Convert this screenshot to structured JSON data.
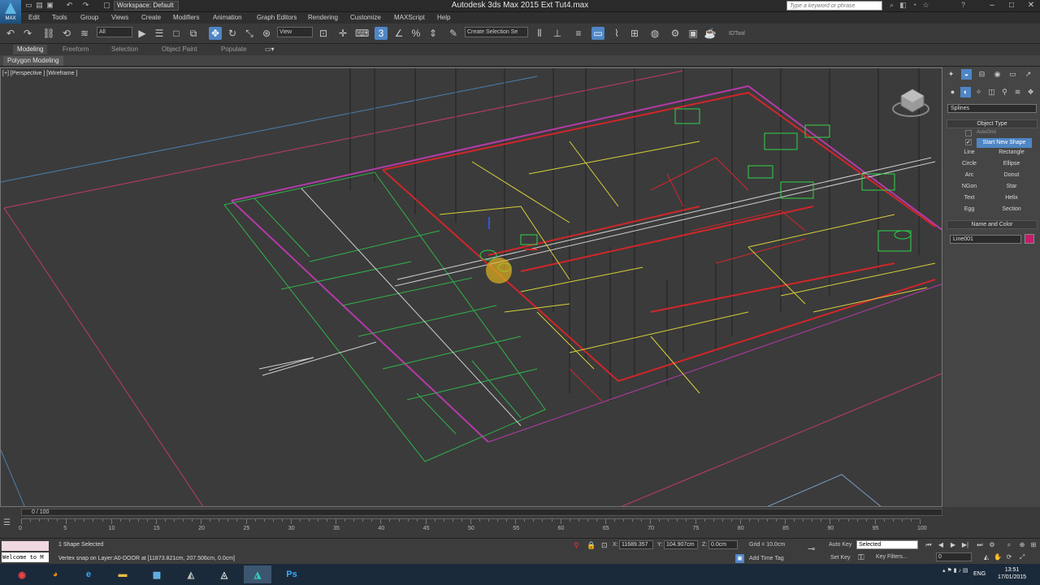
{
  "window": {
    "title": "Autodesk 3ds Max  2015     Ext Tut4.max",
    "workspace": "Workspace: Default",
    "search_placeholder": "Type a keyword or phrase",
    "logo_label": "MAX"
  },
  "menubar": {
    "items": [
      "Edit",
      "Tools",
      "Group",
      "Views",
      "Create",
      "Modifiers",
      "Animation",
      "Graph Editors",
      "Rendering",
      "Customize",
      "MAXScript",
      "Help"
    ]
  },
  "toolbar": {
    "selection_filter": "All",
    "ref_coord": "View",
    "named_selection": "Create Selection Se",
    "idtool_label": "IDTool"
  },
  "ribbon": {
    "tabs": [
      "Modeling",
      "Freeform",
      "Selection",
      "Object Paint",
      "Populate"
    ],
    "active_tab": "Modeling",
    "panel": "Polygon Modeling"
  },
  "viewport": {
    "label": "[+] [Perspective ] [Wireframe ]"
  },
  "command_panel": {
    "category": "Splines",
    "object_type_title": "Object Type",
    "autogrid": "AutoGrid",
    "start_new_shape": "Start New Shape",
    "buttons": [
      [
        "Line",
        "Rectangle"
      ],
      [
        "Circle",
        "Ellipse"
      ],
      [
        "Arc",
        "Donut"
      ],
      [
        "NGon",
        "Star"
      ],
      [
        "Text",
        "Helix"
      ],
      [
        "Egg",
        "Section"
      ]
    ],
    "name_color_title": "Name and Color",
    "object_name": "Line001",
    "object_color": "#c21f6b"
  },
  "timeline": {
    "frame_label": "0 / 100",
    "ticks": [
      "0",
      "5",
      "10",
      "15",
      "20",
      "25",
      "30",
      "35",
      "40",
      "45",
      "50",
      "55",
      "60",
      "65",
      "70",
      "75",
      "80",
      "85",
      "90",
      "95",
      "100"
    ]
  },
  "status": {
    "selection": "1 Shape Selected",
    "prompt": "Vertex snap on Layer:A0-DOOR at [11873.821cm, 207.506cm, 0.0cm]",
    "welcome": "Welcome to M",
    "x_label": "X:",
    "x": "11689.357",
    "y_label": "Y:",
    "y": "104.907cm",
    "z_label": "Z:",
    "z": "0.0cm",
    "grid": "Grid = 10.0cm",
    "add_time_tag": "Add Time Tag",
    "auto_key": "Auto Key",
    "set_key": "Set Key",
    "selected": "Selected",
    "key_filters": "Key Filters...",
    "frame": "0"
  },
  "taskbar": {
    "lang": "ENG",
    "time": "13:51",
    "date": "17/01/2015"
  }
}
